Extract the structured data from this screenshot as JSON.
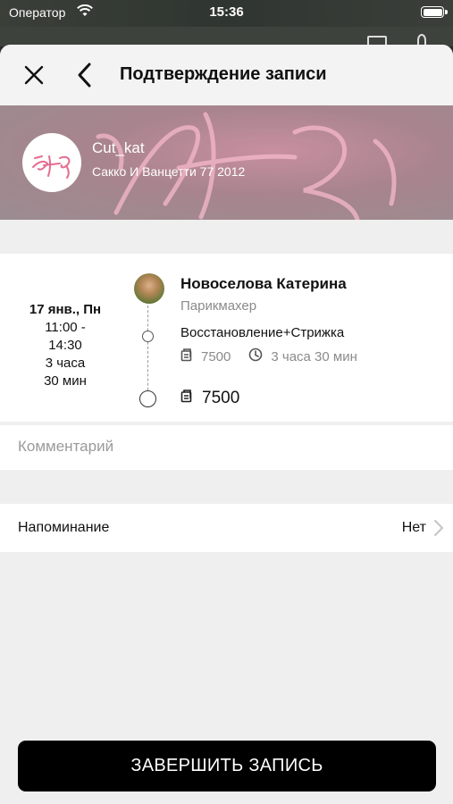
{
  "status_bar": {
    "carrier": "Оператор",
    "time": "15:36"
  },
  "nav": {
    "title": "Подтверждение записи"
  },
  "salon": {
    "name": "Cut_kat",
    "address": "Сакко И Ванцетти 77 2012"
  },
  "booking": {
    "date": "17 янв., Пн",
    "time_line1": "11:00 -",
    "time_line2": "14:30",
    "duration_line1": "3 часа",
    "duration_line2": "30 мин",
    "master_name": "Новоселова Катерина",
    "master_role": "Парикмахер",
    "service_name": "Восстановление+Стрижка",
    "service_price": "7500",
    "service_duration": "3 часа 30 мин",
    "total": "7500"
  },
  "comment": {
    "placeholder": "Комментарий"
  },
  "reminder": {
    "label": "Напоминание",
    "value": "Нет"
  },
  "finish_button": {
    "label": "ЗАВЕРШИТЬ ЗАПИСЬ"
  },
  "colors": {
    "accent": "#000000",
    "hero_tint": "#c88fa0",
    "muted_text": "#8a8a8a"
  },
  "icons": [
    "wifi-icon",
    "battery-icon",
    "close-icon",
    "back-icon",
    "price-tag-icon",
    "clock-icon",
    "chevron-right-icon"
  ]
}
